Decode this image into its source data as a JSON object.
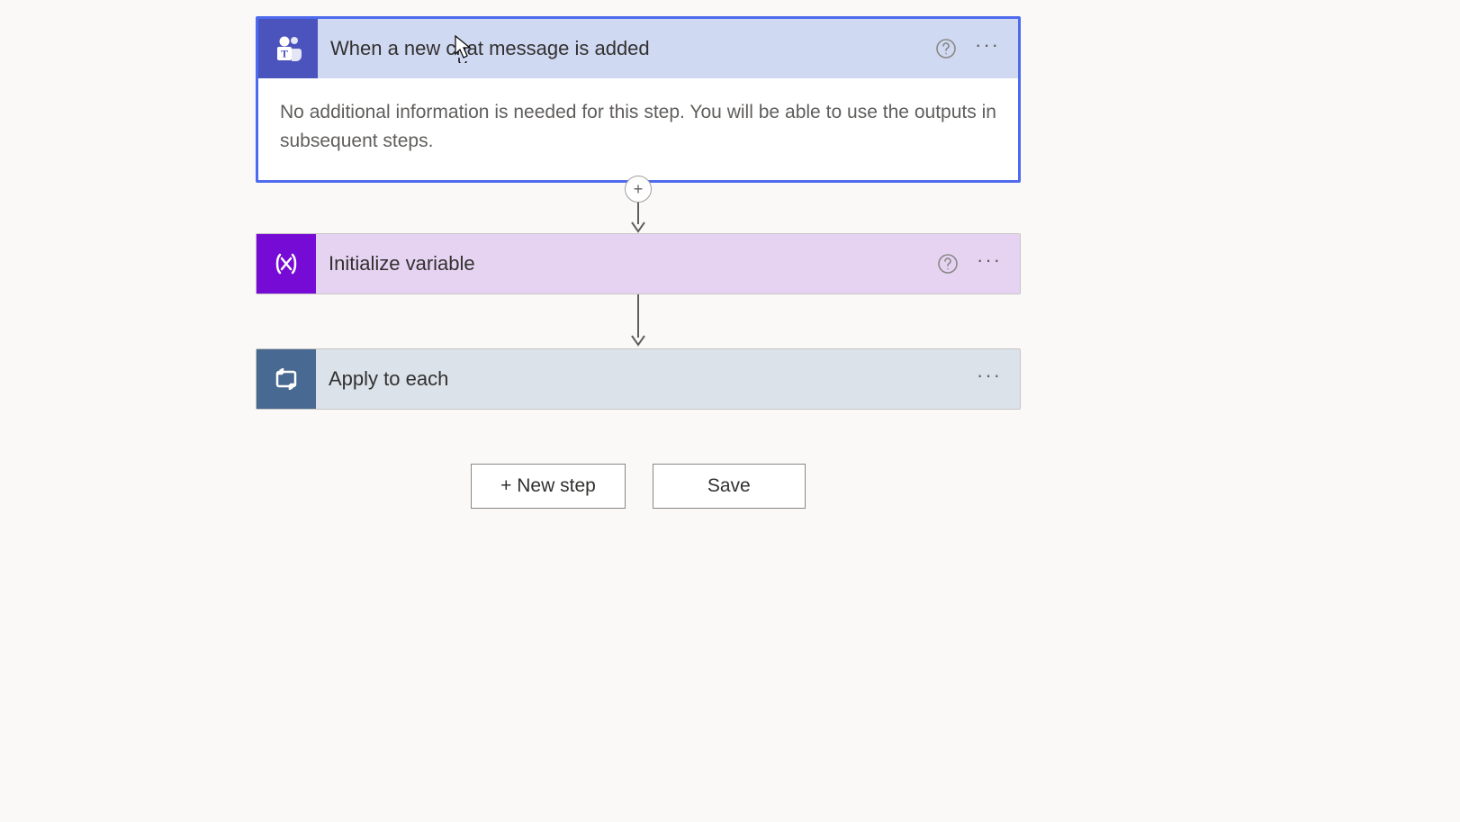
{
  "trigger": {
    "title": "When a new chat message is added",
    "body": "No additional information is needed for this step. You will be able to use the outputs in subsequent steps.",
    "icon_name": "teams-icon"
  },
  "step1": {
    "title": "Initialize variable",
    "icon_name": "variable-icon"
  },
  "step2": {
    "title": "Apply to each",
    "icon_name": "loop-icon"
  },
  "buttons": {
    "new_step": "+ New step",
    "save": "Save"
  },
  "icons": {
    "help": "?",
    "more": "···",
    "plus": "+"
  }
}
